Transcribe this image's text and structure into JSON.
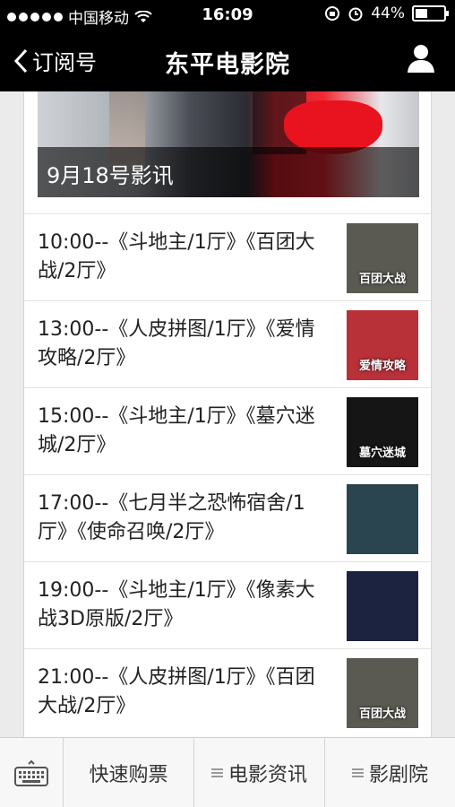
{
  "status": {
    "carrier": "中国移动",
    "time": "16:09",
    "battery_percent": "44%",
    "battery_level": 0.44
  },
  "nav": {
    "back_label": "订阅号",
    "title": "东平电影院"
  },
  "hero": {
    "caption": "9月18号影讯"
  },
  "schedule": [
    {
      "text": "10:00--《斗地主/1厅》《百团大战/2厅》",
      "poster": "百团大战",
      "poster_bg": "#5a5a52"
    },
    {
      "text": "13:00--《人皮拼图/1厅》《爱情攻略/2厅》",
      "poster": "爱情攻略",
      "poster_bg": "#b83038"
    },
    {
      "text": "15:00--《斗地主/1厅》《墓穴迷城/2厅》",
      "poster": "墓穴迷城",
      "poster_bg": "#151515"
    },
    {
      "text": "17:00--《七月半之恐怖宿舍/1厅》《使命召唤/2厅》",
      "poster": "",
      "poster_bg": "#2a4550"
    },
    {
      "text": "19:00--《斗地主/1厅》《像素大战3D原版/2厅》",
      "poster": "",
      "poster_bg": "#1b2340"
    },
    {
      "text": "21:00--《人皮拼图/1厅》《百团大战/2厅》",
      "poster": "百团大战",
      "poster_bg": "#5a5a52"
    }
  ],
  "tabbar": {
    "tab1": "快速购票",
    "tab2": "电影资讯",
    "tab3": "影剧院"
  }
}
